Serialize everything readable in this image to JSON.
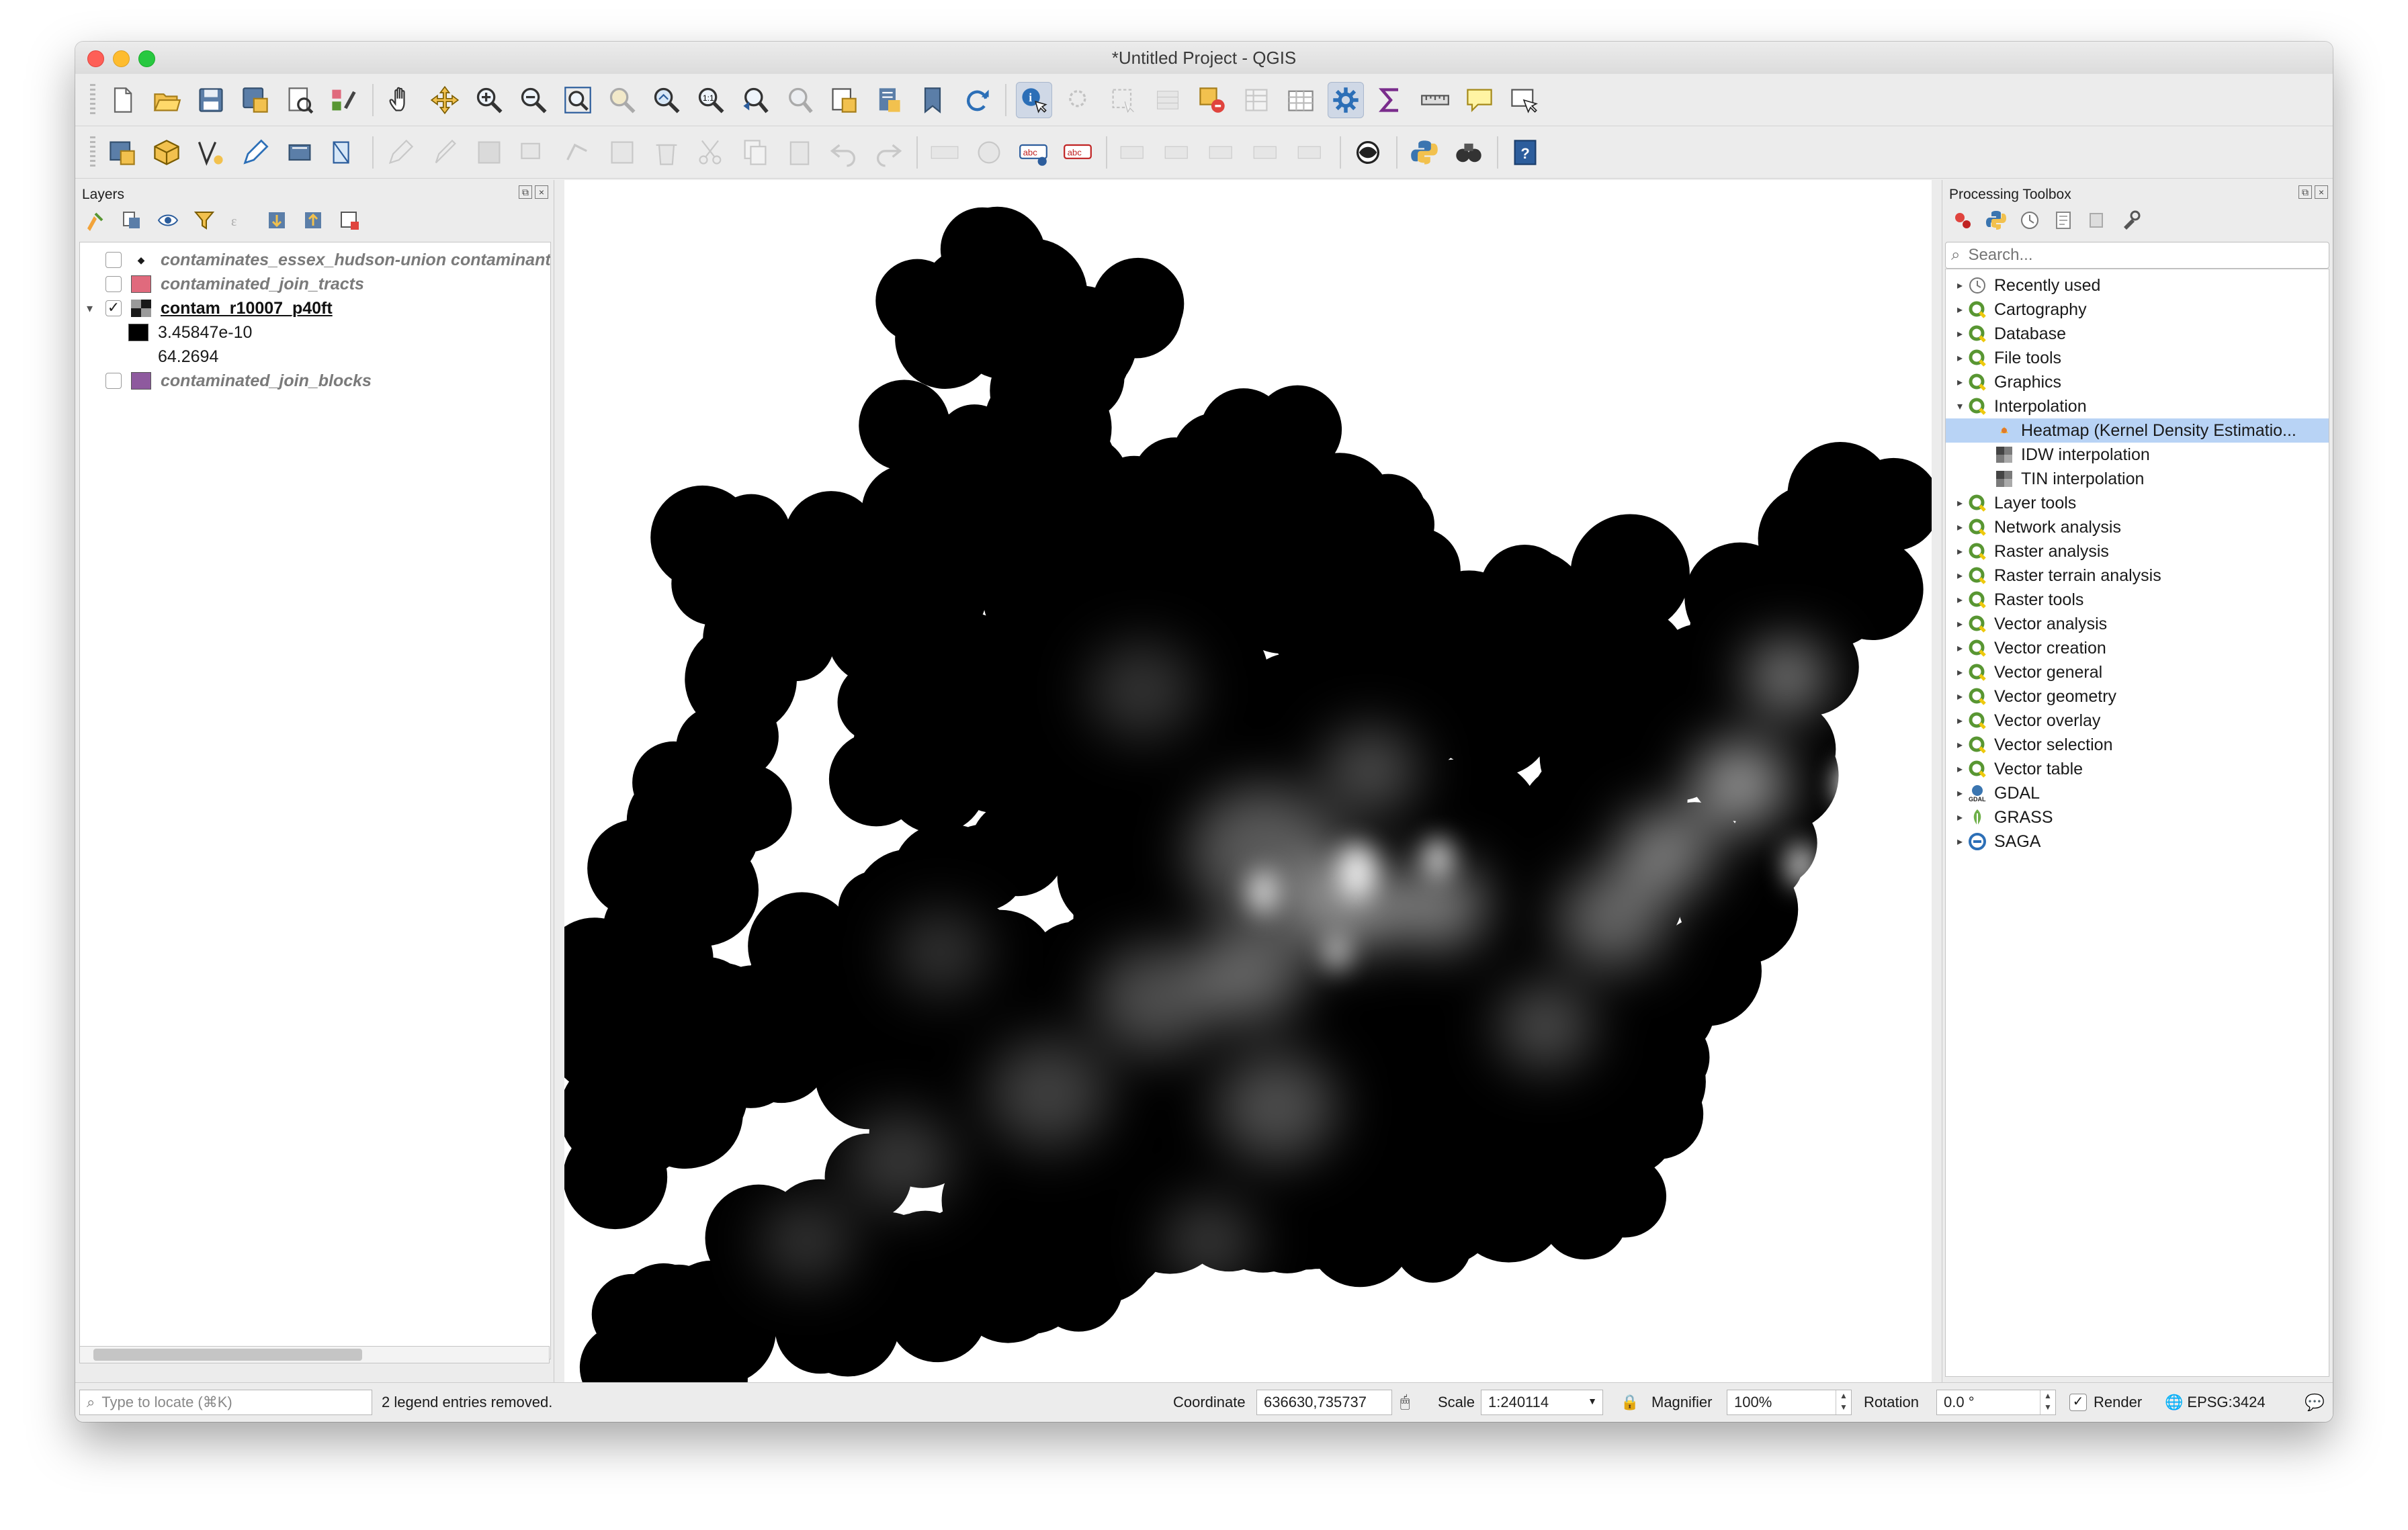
{
  "window": {
    "title": "*Untitled Project - QGIS"
  },
  "colors": {
    "accent": "#b8d3f5",
    "qgis_green": "#589632",
    "qgis_yellow": "#eec90d",
    "tracts_swatch": "#e06a7d",
    "blocks_swatch": "#8e5a9e",
    "raster_low": "#000000",
    "raster_high": "#ffffff"
  },
  "toolbar_primary": [
    "new-project",
    "open-project",
    "save-project",
    "save-as",
    "print-layout",
    "style-manager",
    "pan",
    "pan-to-selection",
    "zoom-in",
    "zoom-out",
    "zoom-full",
    "zoom-to-selection",
    "zoom-to-layer",
    "zoom-native",
    "zoom-last",
    "zoom-next",
    "new-map-view",
    "temporal",
    "new-bookmark",
    "refresh",
    "identify",
    "select-features",
    "deselect",
    "attribute-table",
    "statistics",
    "field-calculator",
    "processing-toolbox",
    "sum",
    "measure",
    "map-tips",
    "annotation"
  ],
  "toolbar_secondary": [
    "data-source-manager",
    "new-geopackage",
    "digitize",
    "edit-pencil",
    "save-edits",
    "add-feature",
    "move-feature",
    "cut",
    "copy",
    "paste",
    "undo",
    "redo",
    "label-tool",
    "pin-labels",
    "show-labels",
    "move-label",
    "rotate-label",
    "change-label",
    "python",
    "plugins",
    "help"
  ],
  "layers_panel": {
    "title": "Layers",
    "items": [
      {
        "name": "contaminates_essex_hudson-union contaminants",
        "checked": false,
        "type": "point"
      },
      {
        "name": "contaminated_join_tracts",
        "checked": false,
        "type": "polygon"
      },
      {
        "name": "contam_r10007_p40ft",
        "checked": true,
        "type": "raster"
      },
      {
        "name": "contaminated_join_blocks",
        "checked": false,
        "type": "polygon"
      }
    ],
    "legend": {
      "min_label": "3.45847e-10",
      "max_label": "64.2694"
    }
  },
  "toolbox_panel": {
    "title": "Processing Toolbox",
    "search_placeholder": "Search...",
    "groups": [
      "Recently used",
      "Cartography",
      "Database",
      "File tools",
      "Graphics",
      "Interpolation",
      "Heatmap (Kernel Density Estimatio...",
      "IDW interpolation",
      "TIN interpolation",
      "Layer tools",
      "Network analysis",
      "Raster analysis",
      "Raster terrain analysis",
      "Raster tools",
      "Vector analysis",
      "Vector creation",
      "Vector general",
      "Vector geometry",
      "Vector overlay",
      "Vector selection",
      "Vector table",
      "GDAL",
      "GRASS",
      "SAGA"
    ]
  },
  "statusbar": {
    "locator_placeholder": "Type to locate (⌘K)",
    "message": "2 legend entries removed.",
    "coordinate_label": "Coordinate",
    "coordinate_value": "636630,735737",
    "scale_label": "Scale",
    "scale_value": "1:240114",
    "magnifier_label": "Magnifier",
    "magnifier_value": "100%",
    "rotation_label": "Rotation",
    "rotation_value": "0.0 °",
    "render_label": "Render",
    "render_checked": true,
    "crs": "EPSG:3424"
  }
}
